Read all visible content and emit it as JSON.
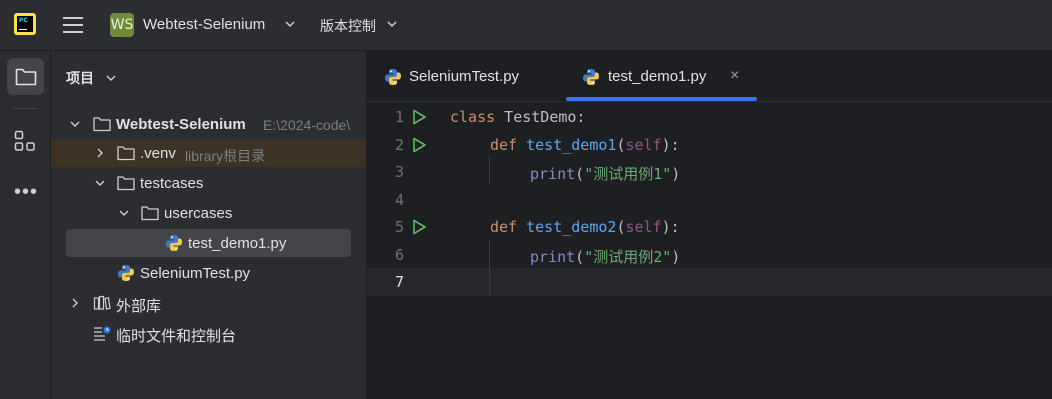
{
  "titlebar": {
    "project_badge": "WS",
    "project_name": "Webtest-Selenium",
    "vcs_menu": "版本控制"
  },
  "icons": {
    "app_logo": "pycharm-logo-icon",
    "menu": "hamburger-menu-icon",
    "project_tool": "folder-icon",
    "structure_tool": "structure-icon",
    "more_tools": "more-icon"
  },
  "project_panel": {
    "title": "项目",
    "tree": [
      {
        "label": "Webtest-Selenium",
        "path": "E:\\2024-code\\",
        "type": "folder"
      },
      {
        "label": ".venv",
        "hint": "library根目录",
        "type": "folder"
      },
      {
        "label": "testcases",
        "type": "folder"
      },
      {
        "label": "usercases",
        "type": "folder"
      },
      {
        "label": "test_demo1.py",
        "type": "python"
      },
      {
        "label": "SeleniumTest.py",
        "type": "python"
      },
      {
        "label": "外部库",
        "type": "library"
      },
      {
        "label": "临时文件和控制台",
        "type": "scratch"
      }
    ]
  },
  "editor_tabs": [
    {
      "label": "SeleniumTest.py",
      "active": false
    },
    {
      "label": "test_demo1.py",
      "active": true,
      "close": "×"
    }
  ],
  "editor": {
    "line_numbers": [
      "1",
      "2",
      "3",
      "4",
      "5",
      "6",
      "7"
    ],
    "code": {
      "l1_kw": "class",
      "l1_name": " TestDemo:",
      "l2_kw": "def",
      "l2_fn": "test_demo1",
      "l2_p1": "(",
      "l2_self": "self",
      "l2_p2": "):",
      "l3_fn": "print",
      "l3_p1": "(",
      "l3_str": "\"测试用例1\"",
      "l3_p2": ")",
      "l5_kw": "def",
      "l5_fn": "test_demo2",
      "l5_p1": "(",
      "l5_self": "self",
      "l5_p2": "):",
      "l6_fn": "print",
      "l6_p1": "(",
      "l6_str": "\"测试用例2\"",
      "l6_p2": ")"
    }
  },
  "colors": {
    "accent": "#3574f0",
    "keyword": "#cf8e6d",
    "function": "#56a8f5",
    "string": "#6aab73",
    "self": "#94558d",
    "run_green": "#5fb85f"
  }
}
